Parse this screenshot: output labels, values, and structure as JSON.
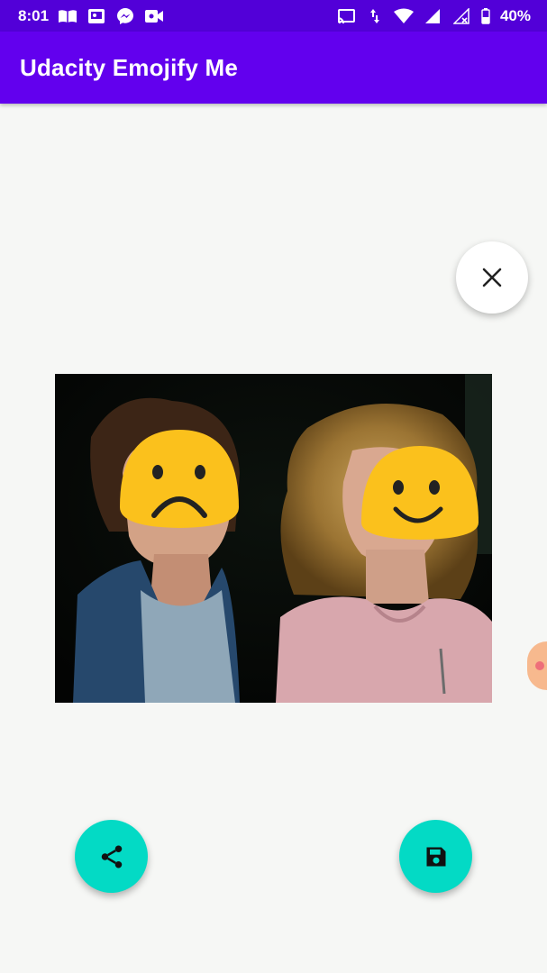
{
  "status_bar": {
    "time": "8:01",
    "battery": "40%",
    "left_icons": [
      "book-icon",
      "cast-screen-icon",
      "messenger-icon",
      "video-camera-icon"
    ],
    "right_icons": [
      "cast-icon",
      "data-arrows-icon",
      "wifi-icon",
      "cell-signal-icon",
      "cell-signal-off-icon",
      "battery-icon"
    ]
  },
  "app_bar": {
    "title": "Udacity Emojify Me"
  },
  "emojified_photo": {
    "faces": [
      {
        "emoji": "frowning-face"
      },
      {
        "emoji": "smiling-face"
      }
    ]
  },
  "actions": {
    "clear_icon": "close-icon",
    "share_icon": "share-icon",
    "save_icon": "save-icon"
  },
  "colors": {
    "status_bar": "#5200d8",
    "app_bar": "#6200ee",
    "fab": "#03dac5",
    "background": "#f6f7f5",
    "emoji": "#fbc11c"
  }
}
